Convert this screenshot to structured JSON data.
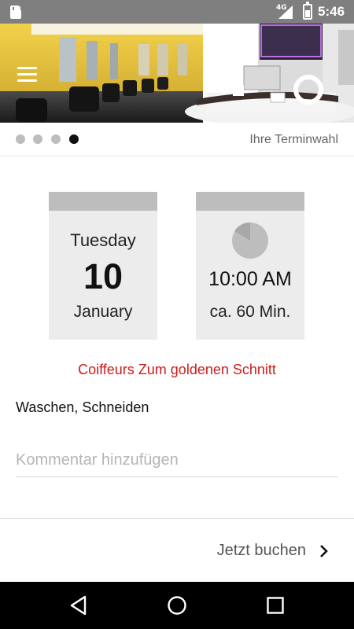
{
  "status_bar": {
    "network": "4G",
    "time": "5:46",
    "icons": [
      "sd-card-icon",
      "signal-icon",
      "battery-icon"
    ]
  },
  "header": {
    "menu_icon": "hamburger-menu-icon",
    "image": "salon-interior-photo"
  },
  "pager": {
    "title": "Ihre Terminwahl",
    "steps": 4,
    "active_step": 4
  },
  "appointment": {
    "weekday": "Tuesday",
    "day": "10",
    "month": "January",
    "time": "10:00 AM",
    "duration": "ca. 60 Min.",
    "clock_icon": "clock-progress-icon"
  },
  "salon_name": "Coiffeurs Zum goldenen Schnitt",
  "services": "Waschen, Schneiden",
  "comment": {
    "value": "",
    "placeholder": "Kommentar hinzufügen"
  },
  "book": {
    "label": "Jetzt buchen",
    "icon": "chevron-right-icon"
  },
  "nav_bar": {
    "icons": [
      "back-icon",
      "home-icon",
      "recents-icon"
    ]
  },
  "colors": {
    "accent_red": "#cc1b1b",
    "status_bar": "#7f7f7f",
    "card_bg": "#ececec",
    "card_header": "#bdbdbd"
  }
}
